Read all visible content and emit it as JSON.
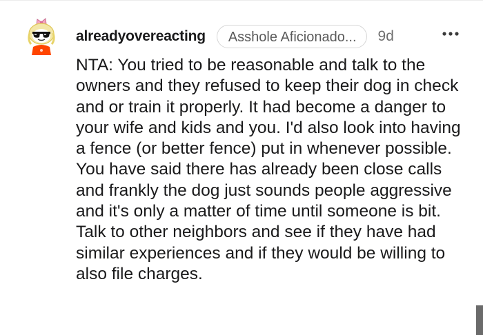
{
  "comment": {
    "username": "alreadyovereacting",
    "flair": "Asshole Aficionado...",
    "timestamp": "9d",
    "more_icon": "more-horizontal-icon",
    "avatar_icon": "snoo-avatar-with-sunglasses",
    "body": "NTA: You tried to be reasonable and talk to the owners and they refused to keep their dog in check and or train it properly. It had become a danger to your wife and kids and you. I'd also look into having a fence (or better fence) put in whenever possible. You have said there has already been close calls and frankly the dog just sounds people aggressive and it's only a matter of time until someone is bit. Talk to other neighbors and see if they have had similar experiences and if they would be willing to also file charges."
  },
  "colors": {
    "text": "#1a1a1b",
    "muted": "#6f6f6f",
    "flair_border": "#d6d6d6",
    "avatar_accent": "#ff4500"
  }
}
